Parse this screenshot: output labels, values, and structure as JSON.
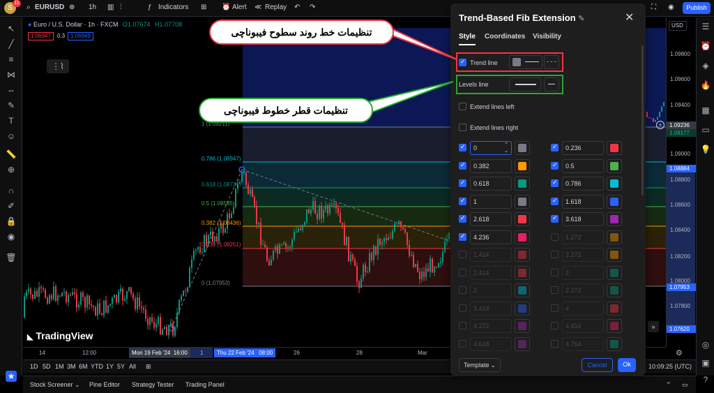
{
  "topbar": {
    "avatar_letter": "S",
    "notifications": "11",
    "symbol": "EURUSD",
    "interval": "1h",
    "indicators": "Indicators",
    "alert": "Alert",
    "replay": "Replay",
    "publish": "Publish"
  },
  "symbol_row": {
    "title": "Euro / U.S. Dollar · 1h · FXCM",
    "o": "O1.07674",
    "h": "H1.07708",
    "l": "L",
    "sell": "1.06947",
    "spread": "0.3",
    "buy": "1.06949"
  },
  "price_axis": {
    "currency": "USD",
    "labels": [
      "1.09800",
      "1.09600",
      "1.09400",
      "1.09000",
      "1.08800",
      "1.08600",
      "1.08400",
      "1.08200",
      "1.08000",
      "1.07800"
    ],
    "current": "1.09236",
    "current2": "1.09177",
    "box_top": "1.08884",
    "box_mid": "1.07953",
    "box_bot": "1.07620"
  },
  "time_axis": {
    "labels": [
      "14",
      "12:00",
      "1",
      "26",
      "28",
      "Mar"
    ],
    "box_left": "Mon 19 Feb '24",
    "box_left_time": "16:00",
    "box_right": "Thu 22 Feb '24",
    "box_right_time": "08:00"
  },
  "range_bar": {
    "ranges": [
      "1D",
      "5D",
      "1M",
      "3M",
      "6M",
      "YTD",
      "1Y",
      "5Y",
      "All"
    ],
    "clock": "10:09:25 (UTC)"
  },
  "bottom_tabs": [
    "Stock Screener",
    "Pine Editor",
    "Strategy Tester",
    "Trading Panel"
  ],
  "watermark": "TradingView",
  "fib_labels": [
    {
      "text": "1 (1.09211)",
      "color": "#787b86"
    },
    {
      "text": "0.786 (1.08947)",
      "color": "#00bcd4"
    },
    {
      "text": "0.618 (1.08734)",
      "color": "#089981"
    },
    {
      "text": "0.5 (1.08585)",
      "color": "#4caf50"
    },
    {
      "text": "0.382 (1.08436)",
      "color": "#ff9800"
    },
    {
      "text": "0.236 (1.08251)",
      "color": "#f23645"
    },
    {
      "text": "0 (1.07953)",
      "color": "#787b86"
    }
  ],
  "dialog": {
    "title": "Trend-Based Fib Extension",
    "tabs": [
      "Style",
      "Coordinates",
      "Visibility"
    ],
    "trend_line": "Trend line",
    "levels_line": "Levels line",
    "extend_left": "Extend lines left",
    "extend_right": "Extend lines right",
    "template": "Template",
    "cancel": "Cancel",
    "ok": "Ok",
    "levels_left": [
      {
        "v": "0",
        "c": "#787b86",
        "on": true
      },
      {
        "v": "0.382",
        "c": "#ff9800",
        "on": true
      },
      {
        "v": "0.618",
        "c": "#089981",
        "on": true
      },
      {
        "v": "1",
        "c": "#787b86",
        "on": true
      },
      {
        "v": "2.618",
        "c": "#f23645",
        "on": true
      },
      {
        "v": "4.236",
        "c": "#e91e63",
        "on": true
      },
      {
        "v": "1.414",
        "c": "#f23645",
        "on": false
      },
      {
        "v": "2.414",
        "c": "#f23645",
        "on": false
      },
      {
        "v": "2",
        "c": "#00bcd4",
        "on": false
      },
      {
        "v": "3.414",
        "c": "#2962ff",
        "on": false
      },
      {
        "v": "4.272",
        "c": "#9c27b0",
        "on": false
      },
      {
        "v": "4.618",
        "c": "#9c27b0",
        "on": false
      }
    ],
    "levels_right": [
      {
        "v": "0.236",
        "c": "#f23645",
        "on": true
      },
      {
        "v": "0.5",
        "c": "#4caf50",
        "on": true
      },
      {
        "v": "0.786",
        "c": "#00bcd4",
        "on": true
      },
      {
        "v": "1.618",
        "c": "#2962ff",
        "on": true
      },
      {
        "v": "3.618",
        "c": "#9c27b0",
        "on": true
      },
      {
        "v": "1.272",
        "c": "#ff9800",
        "on": false
      },
      {
        "v": "2.272",
        "c": "#ff9800",
        "on": false
      },
      {
        "v": "2",
        "c": "#089981",
        "on": false
      },
      {
        "v": "2.272",
        "c": "#089981",
        "on": false
      },
      {
        "v": "4",
        "c": "#f23645",
        "on": false
      },
      {
        "v": "4.414",
        "c": "#e91e63",
        "on": false
      },
      {
        "v": "4.764",
        "c": "#089981",
        "on": false
      }
    ]
  },
  "callouts": {
    "trend": "تنظیمات خط روند سطوح فیبوناچی",
    "levels": "تنظیمات قطر خطوط فیبوناچی"
  }
}
